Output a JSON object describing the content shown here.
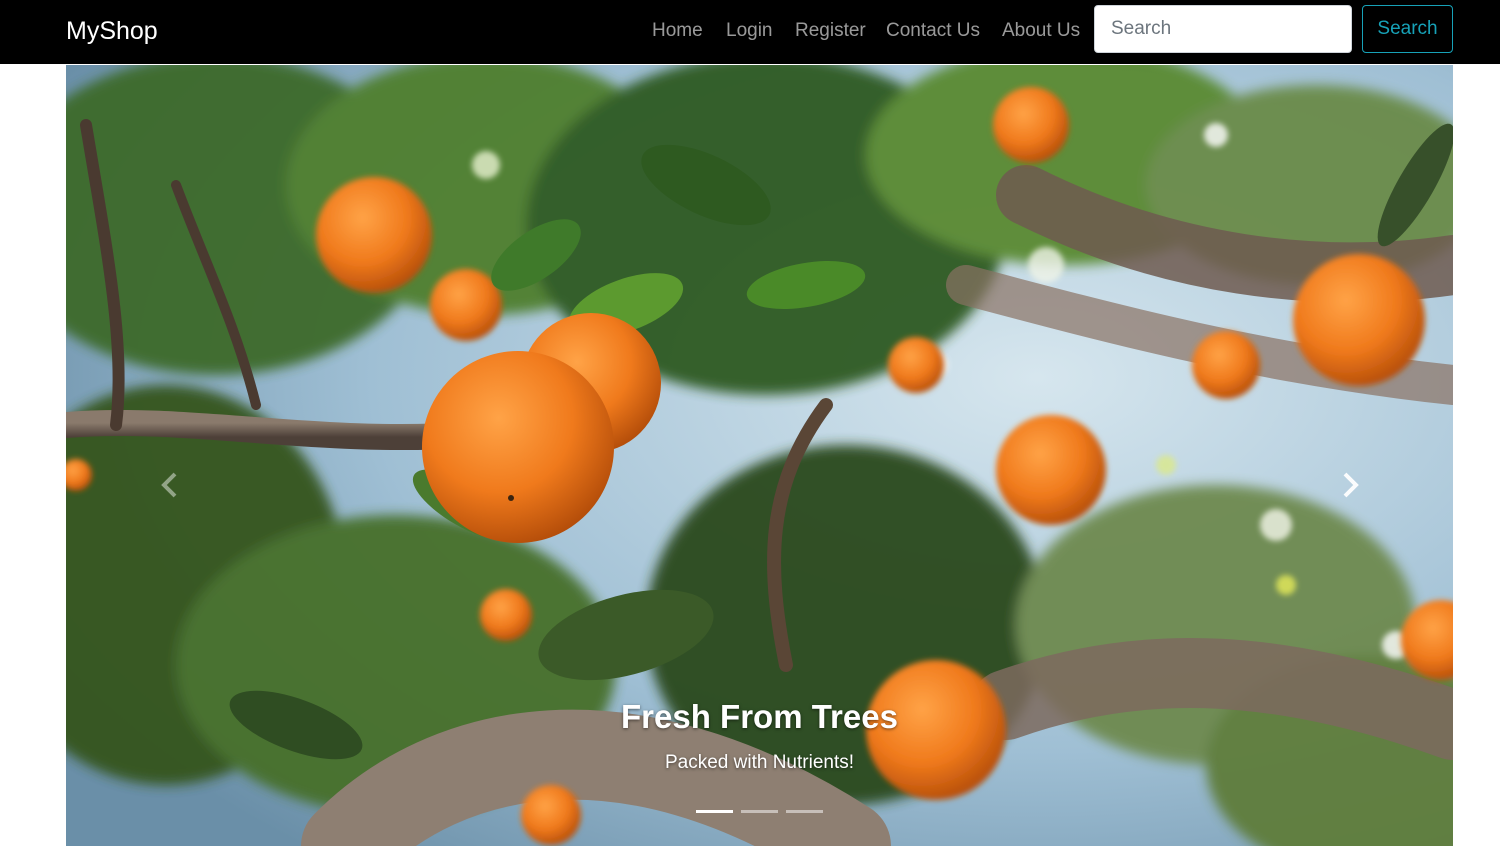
{
  "navbar": {
    "brand": "MyShop",
    "links": [
      "Home",
      "Login",
      "Register",
      "Contact Us",
      "About Us"
    ],
    "search_placeholder": "Search",
    "search_button": "Search"
  },
  "carousel": {
    "slide": {
      "image": "orange-tree-photo",
      "title": "Fresh From Trees",
      "text": "Packed with Nutrients!"
    },
    "prev_icon": "chevron-left-icon",
    "next_icon": "chevron-right-icon",
    "indicator_count": 3,
    "active_indicator": 1
  },
  "colors": {
    "navbar_bg": "#000000",
    "accent": "#17a2b8",
    "orange": "#f07a1c"
  }
}
